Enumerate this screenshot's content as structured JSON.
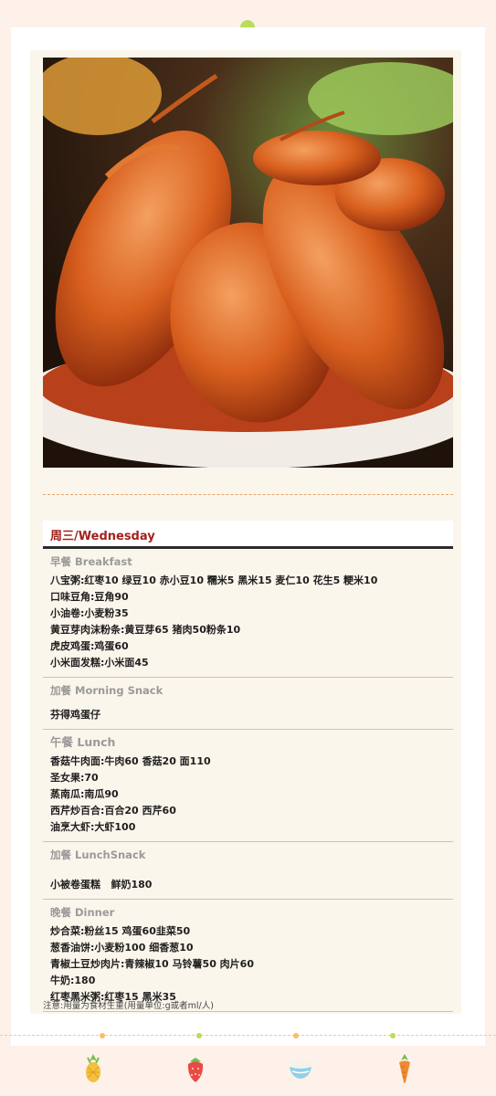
{
  "day": {
    "title": "周三/Wednesday"
  },
  "sections": {
    "breakfast": {
      "heading": "早餐 Breakfast",
      "items": [
        "八宝粥:红枣10 绿豆10 赤小豆10 糯米5 黑米15 麦仁10 花生5 粳米10",
        "口味豆角:豆角90",
        "小油卷:小麦粉35",
        "黄豆芽肉沫粉条:黄豆芽65 猪肉50粉条10",
        "虎皮鸡蛋:鸡蛋60",
        "小米面发糕:小米面45"
      ]
    },
    "morning_snack": {
      "heading": "加餐 Morning Snack",
      "items": [
        "芬得鸡蛋仔"
      ]
    },
    "lunch": {
      "heading": "午餐 Lunch",
      "items": [
        "香菇牛肉面:牛肉60 香菇20 面110",
        "圣女果:70",
        "蒸南瓜:南瓜90",
        "西芹炒百合:百合20 西芹60",
        "油烹大虾:大虾100"
      ]
    },
    "lunch_snack": {
      "heading": "加餐 LunchSnack",
      "items": [
        "小被卷蛋糕   鲜奶180"
      ]
    },
    "dinner": {
      "heading": "晚餐 Dinner",
      "items": [
        "炒合菜:粉丝15 鸡蛋60韭菜50",
        "葱香油饼:小麦粉100 细香葱10",
        "青椒土豆炒肉片:青辣椒10 马铃薯50 肉片60",
        "牛奶:180",
        "红枣黑米粥:红枣15 黑米35"
      ]
    }
  },
  "note": "注意:用量为食材生重(用量单位:g或者ml/人)",
  "icons": [
    "pineapple-icon",
    "strawberry-icon",
    "rice-bowl-icon",
    "carrot-icon"
  ],
  "colors": {
    "title_red": "#a2221c",
    "background": "#fdf1ea",
    "accent_green": "#b9dc5a",
    "dash_orange": "#e8a46a"
  }
}
